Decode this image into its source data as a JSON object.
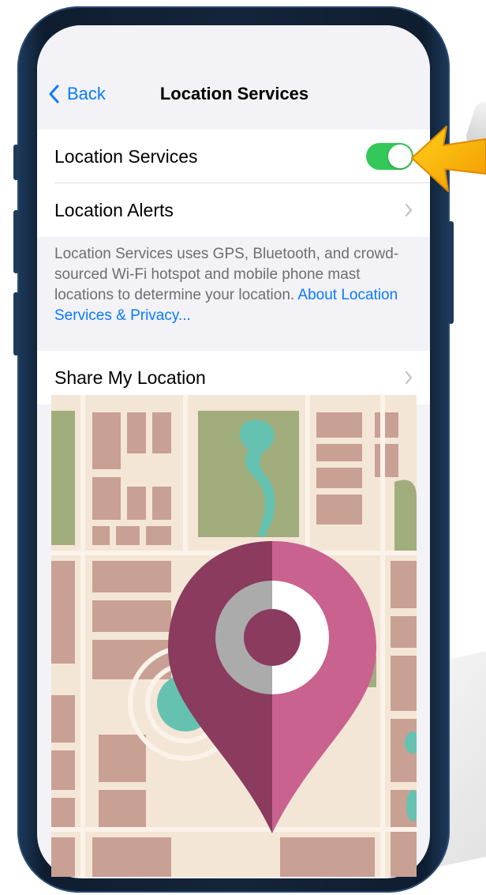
{
  "nav": {
    "back_label": "Back",
    "title": "Location Services"
  },
  "settings": {
    "rows": [
      {
        "label": "Location Services",
        "control": "toggle",
        "toggle_on": true
      },
      {
        "label": "Location Alerts",
        "control": "chevron"
      }
    ],
    "footer": {
      "text": "Location Services uses GPS, Bluetooth, and crowd-sourced Wi-Fi hotspot and mobile phone mast locations to determine your location. ",
      "link": "About Location Services & Privacy..."
    },
    "share_row": {
      "label": "Share My Location",
      "control": "chevron"
    }
  },
  "icons": {
    "back": "chevron-left-icon",
    "disclosure": "chevron-right-icon",
    "pointer": "arrow-pointer-icon",
    "map_pin": "map-pin-icon"
  },
  "colors": {
    "accent": "#0a7aff",
    "toggle_on": "#34c759",
    "pointer_arrow": "#f7b500",
    "pin_dark": "#8a3b5e",
    "pin_light": "#c9628f"
  }
}
